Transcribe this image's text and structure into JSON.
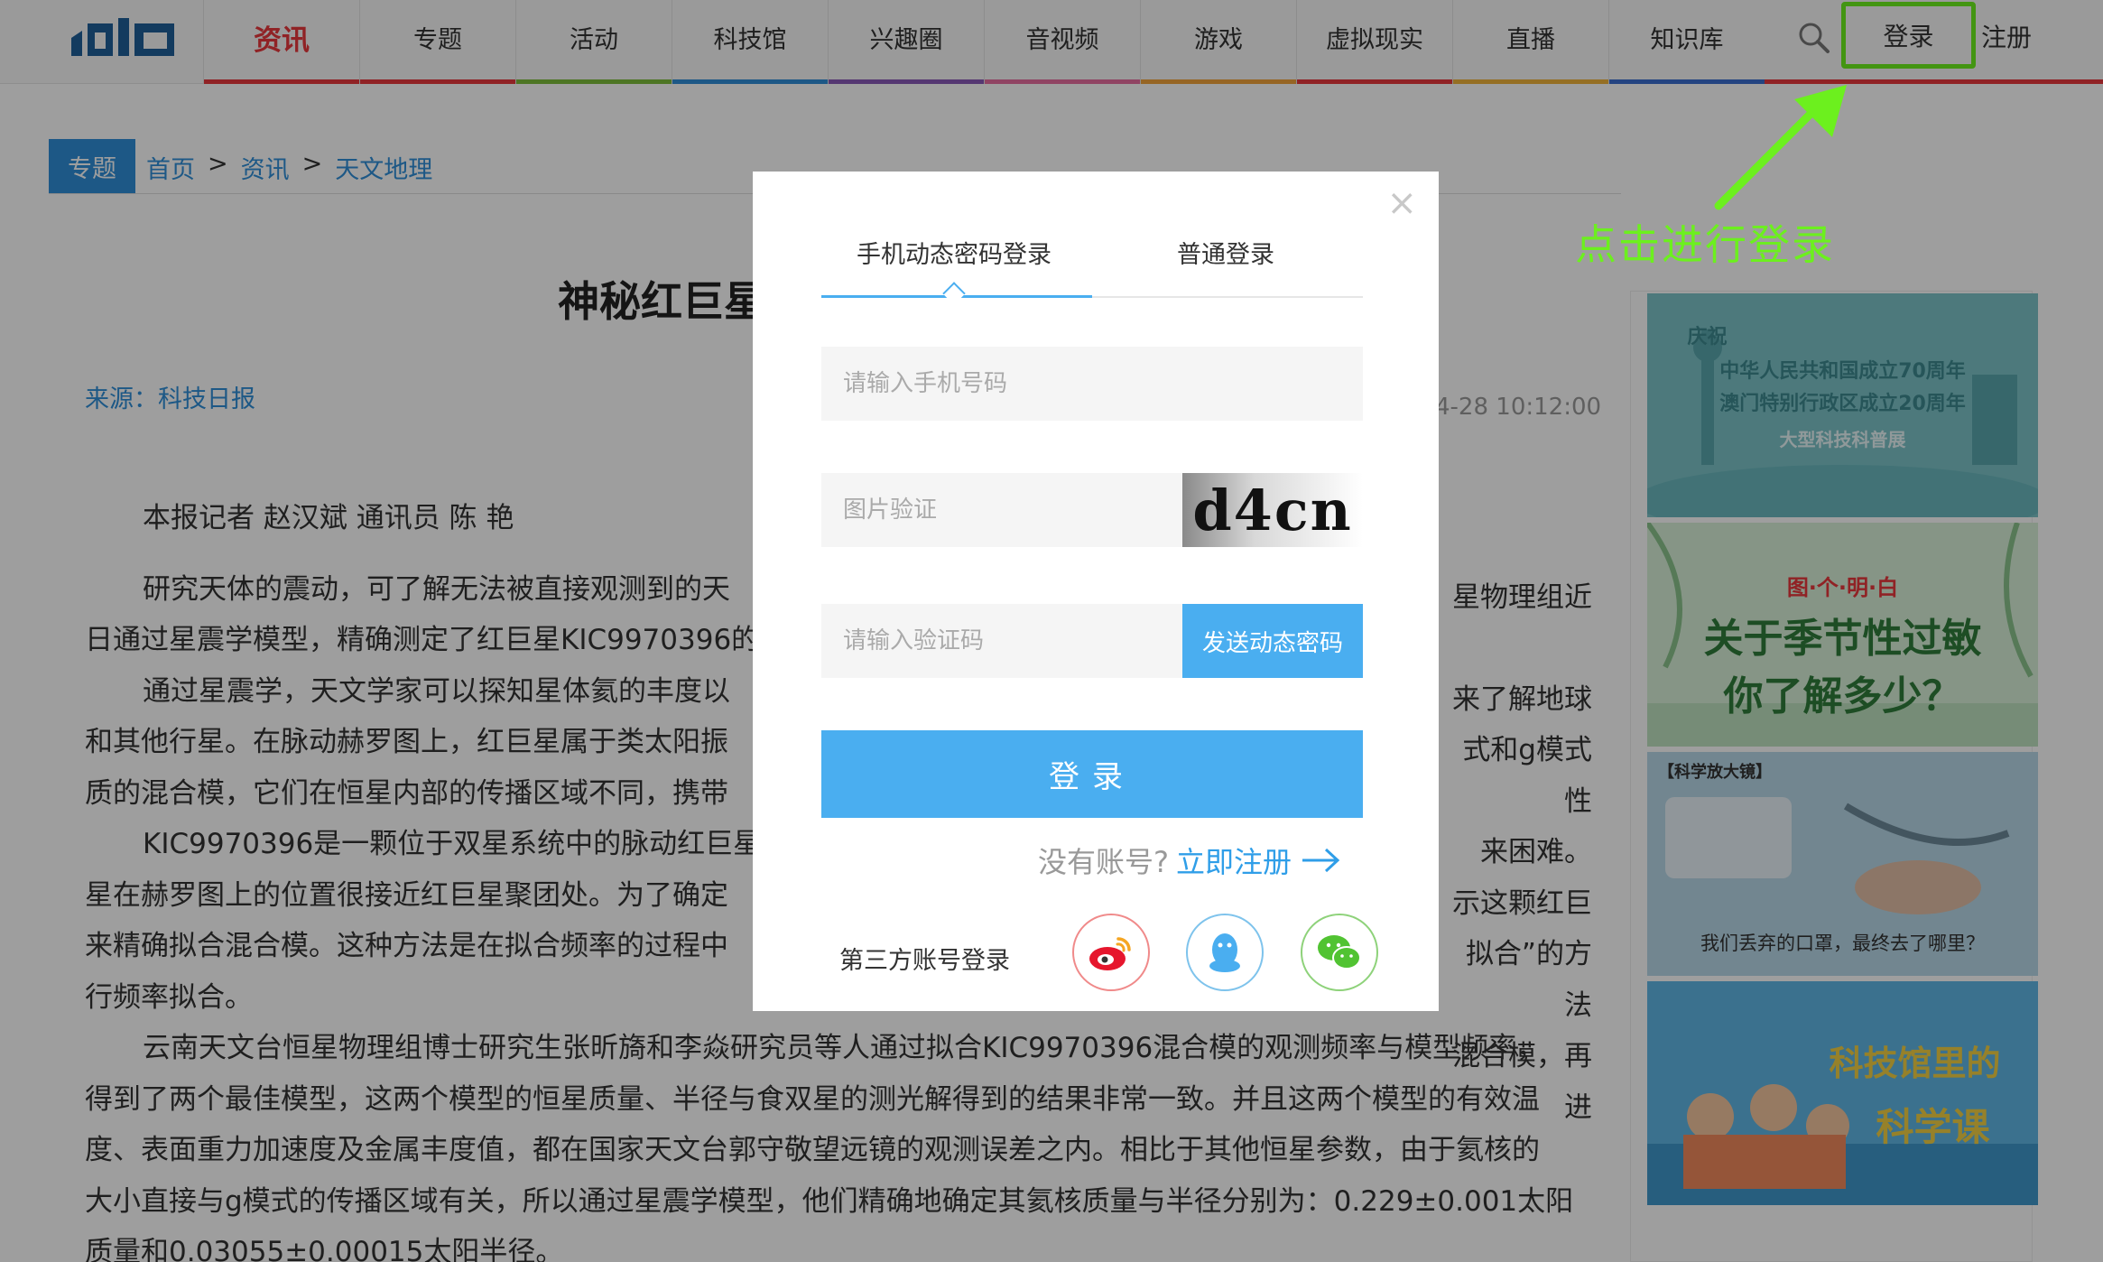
{
  "nav": {
    "items": [
      {
        "label": "资讯",
        "active": true,
        "color": "#e8383d"
      },
      {
        "label": "专题",
        "color": "#e8383d"
      },
      {
        "label": "活动",
        "color": "#7cbd3b"
      },
      {
        "label": "科技馆",
        "color": "#2f8fd8"
      },
      {
        "label": "兴趣圈",
        "color": "#8a5ab8"
      },
      {
        "label": "音视频",
        "color": "#e96fa0"
      },
      {
        "label": "游戏",
        "color": "#f2a33a"
      },
      {
        "label": "虚拟现实",
        "color": "#e8383d"
      },
      {
        "label": "直播",
        "color": "#f0b43a"
      },
      {
        "label": "知识库",
        "color": "#3b6fd1"
      }
    ],
    "login_label": "登录",
    "register_label": "注册"
  },
  "breadcrumb": {
    "tag": "专题",
    "home": "首页",
    "section": "资讯",
    "category": "天文地理",
    "sep": ">"
  },
  "article": {
    "title_visible": "神秘红巨星",
    "source": "来源：科技日报",
    "time_visible": "4-28 10:12:00",
    "byline": "本报记者 赵汉斌 通讯员 陈 艳",
    "paragraphs": [
      "研究天体的震动，可了解无法被直接观测到的天",
      "日通过星震学模型，精确测定了红巨星KIC9970396的",
      "通过星震学，天文学家可以探知星体氦的丰度以",
      "和其他行星。在脉动赫罗图上，红巨星属于类太阳振",
      "质的混合模，它们在恒星内部的传播区域不同，携带",
      "KIC9970396是一颗位于双星系统中的脉动红巨星",
      "星在赫罗图上的位置很接近红巨星聚团处。为了确定",
      "来精确拟合混合模。这种方法是在拟合频率的过程中",
      "行频率拟合。",
      "云南天文台恒星物理组博士研究生张昕旖和李焱研究员等人通过拟合KIC9970396混合模的观测频率与模型频率，",
      "得到了两个最佳模型，这两个模型的恒星质量、半径与食双星的测光解得到的结果非常一致。并且这两个模型的有效温",
      "度、表面重力加速度及金属丰度值，都在国家天文台郭守敬望远镜的观测误差之内。相比于其他恒星参数，由于氦核的",
      "大小直接与g模式的传播区域有关，所以通过星震学模型，他们精确地确定其氦核质量与半径分别为：0.229±0.001太阳",
      "质量和0.03055±0.00015太阳半径。"
    ],
    "right_fragments": [
      "星物理组近",
      "来了解地球",
      "式和g模式性",
      "来困难。",
      "示这颗红巨",
      "拟合”的方法",
      "混合模，再进"
    ]
  },
  "sidebar": {
    "ad1": {
      "line1": "庆祝",
      "line2": "中华人民共和国成立70周年",
      "line3": "澳门特别行政区成立20周年",
      "line4": "大型科技科普展"
    },
    "ad2": {
      "top": "图·个·明·白",
      "line1": "关于季节性过敏",
      "line2": "你了解多少？"
    },
    "ad3": {
      "tag": "【科学放大镜】",
      "caption": "我们丢弃的口罩，最终去了哪里？"
    },
    "ad4": {
      "line1": "科技馆里的",
      "line2": "科学课"
    }
  },
  "annotation": {
    "text": "点击进行登录",
    "color": "#6cf01e"
  },
  "modal": {
    "tab_sms": "手机动态密码登录",
    "tab_normal": "普通登录",
    "phone_placeholder": "请输入手机号码",
    "captcha_placeholder": "图片验证",
    "captcha_text": "d4cn",
    "code_placeholder": "请输入验证码",
    "send_code_label": "发送动态密码",
    "login_label": "登录",
    "no_account": "没有账号?",
    "register_now": "立即注册",
    "third_party_label": "第三方账号登录",
    "close_label": "×"
  },
  "colors": {
    "accent": "#4aaef0",
    "brand_red": "#e8383d",
    "highlight_green": "#6cf01e"
  }
}
